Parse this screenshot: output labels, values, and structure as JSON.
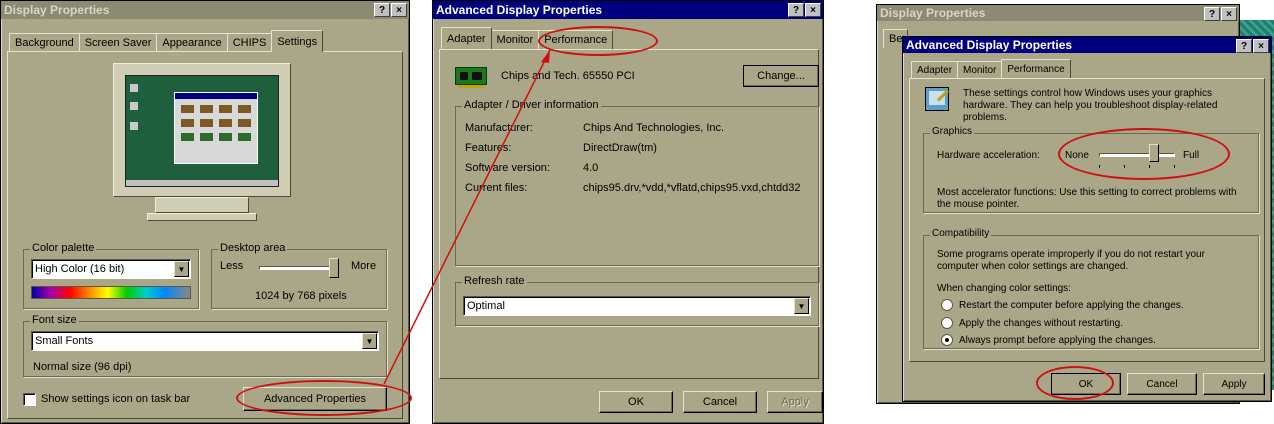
{
  "win1": {
    "title": "Display Properties",
    "title_buttons": [
      "?",
      "×"
    ],
    "tabs": [
      "Background",
      "Screen Saver",
      "Appearance",
      "CHIPS",
      "Settings"
    ],
    "selected_tab": "Settings",
    "color_palette": {
      "label": "Color palette",
      "value": "High Color (16 bit)"
    },
    "desktop_area": {
      "label": "Desktop area",
      "less": "Less",
      "more": "More",
      "resolution": "1024 by 768 pixels",
      "level": 1.0
    },
    "font_size": {
      "label": "Font size",
      "value": "Small Fonts",
      "note": "Normal size (96 dpi)"
    },
    "show_icon_label": "Show settings icon on task bar",
    "advanced_button": "Advanced Properties"
  },
  "win2": {
    "title": "Advanced Display Properties",
    "title_buttons": [
      "?",
      "×"
    ],
    "tabs": [
      "Adapter",
      "Monitor",
      "Performance"
    ],
    "selected_tab": "Adapter",
    "adapter_name": "Chips and Tech. 65550 PCI",
    "change_button": "Change...",
    "info_group_label": "Adapter / Driver information",
    "info": [
      {
        "label": "Manufacturer:",
        "value": "Chips And Technologies, Inc."
      },
      {
        "label": "Features:",
        "value": "DirectDraw(tm)"
      },
      {
        "label": "Software version:",
        "value": "4.0"
      },
      {
        "label": "Current files:",
        "value": "chips95.drv,*vdd,*vflatd,chips95.vxd,chtdd32"
      }
    ],
    "refresh_group_label": "Refresh rate",
    "refresh_value": "Optimal",
    "buttons": {
      "ok": "OK",
      "cancel": "Cancel",
      "apply": "Apply"
    }
  },
  "win3": {
    "back_title": "Display Properties",
    "back_tab_stub": "Be",
    "title": "Advanced Display Properties",
    "title_buttons": [
      "?",
      "×"
    ],
    "tabs": [
      "Adapter",
      "Monitor",
      "Performance"
    ],
    "selected_tab": "Performance",
    "intro": "These settings control how Windows uses your graphics hardware. They can help you troubleshoot display-related problems.",
    "graphics": {
      "label": "Graphics",
      "hw_label": "Hardware acceleration:",
      "none": "None",
      "full": "Full",
      "level": 0.75,
      "desc": "Most accelerator functions: Use this setting to correct problems with the mouse pointer."
    },
    "compat": {
      "label": "Compatibility",
      "desc": "Some programs operate improperly if you do not restart your computer when color settings are changed.",
      "when": "When changing color settings:",
      "options": [
        "Restart the computer before applying the changes.",
        "Apply the changes without restarting.",
        "Always prompt before applying the changes."
      ],
      "selected_index": 2
    },
    "buttons": {
      "ok": "OK",
      "cancel": "Cancel",
      "apply": "Apply"
    }
  },
  "colors": {
    "face": "#a9a787",
    "title_active": "#00007f",
    "annotation": "#d01010",
    "desktop": "#1f5f3e"
  }
}
